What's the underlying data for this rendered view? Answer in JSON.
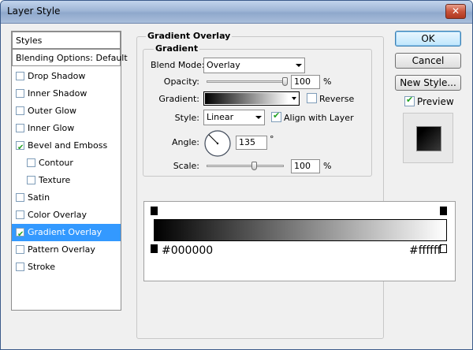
{
  "window": {
    "title": "Layer Style",
    "close_glyph": "✕"
  },
  "styles_list": {
    "header": "Styles",
    "blending": "Blending Options: Default",
    "items": [
      {
        "label": "Drop Shadow",
        "checked": false
      },
      {
        "label": "Inner Shadow",
        "checked": false
      },
      {
        "label": "Outer Glow",
        "checked": false
      },
      {
        "label": "Inner Glow",
        "checked": false
      },
      {
        "label": "Bevel and Emboss",
        "checked": true
      },
      {
        "label": "Contour",
        "checked": false,
        "sub": true
      },
      {
        "label": "Texture",
        "checked": false,
        "sub": true
      },
      {
        "label": "Satin",
        "checked": false
      },
      {
        "label": "Color Overlay",
        "checked": false
      },
      {
        "label": "Gradient Overlay",
        "checked": true,
        "selected": true
      },
      {
        "label": "Pattern Overlay",
        "checked": false
      },
      {
        "label": "Stroke",
        "checked": false
      }
    ]
  },
  "panel": {
    "title": "Gradient Overlay",
    "group_title": "Gradient",
    "blend_mode_label": "Blend Mode:",
    "blend_mode_value": "Overlay",
    "opacity_label": "Opacity:",
    "opacity_value": "100",
    "opacity_unit": "%",
    "opacity_level": 1.0,
    "gradient_label": "Gradient:",
    "reverse_label": "Reverse",
    "reverse_checked": false,
    "style_label": "Style:",
    "style_value": "Linear",
    "align_label": "Align with Layer",
    "align_checked": true,
    "angle_label": "Angle:",
    "angle_value": "135",
    "angle_unit": "°",
    "scale_label": "Scale:",
    "scale_value": "100",
    "scale_unit": "%",
    "scale_level": 0.5
  },
  "buttons": {
    "ok": "OK",
    "cancel": "Cancel",
    "new_style": "New Style..."
  },
  "preview": {
    "label": "Preview",
    "checked": true
  },
  "gradient_editor": {
    "start_color": "#000000",
    "end_color": "#ffffff"
  },
  "colors": {
    "selection": "#3399ff",
    "check": "#21a121"
  }
}
